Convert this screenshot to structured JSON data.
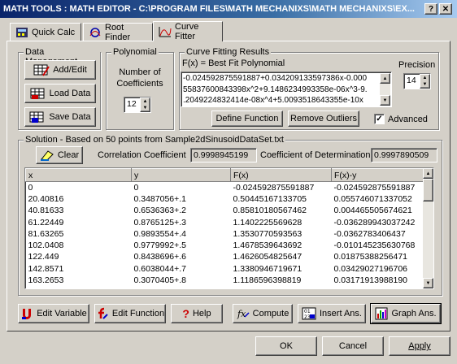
{
  "window": {
    "title": "MATH TOOLS : MATH EDITOR - C:\\PROGRAM FILES\\MATH MECHANIXS\\MATH MECHANIXS\\EX...",
    "help_label": "?",
    "close_label": "✕"
  },
  "tabs": [
    {
      "label": "Quick Calc",
      "icon": "calculator-icon"
    },
    {
      "label": "Root Finder",
      "icon": "root-finder-icon"
    },
    {
      "label": "Curve Fitter",
      "icon": "curve-icon",
      "active": true
    }
  ],
  "data_management": {
    "title": "Data Management",
    "add_edit": "Add/Edit",
    "load_data": "Load Data",
    "save_data": "Save Data"
  },
  "polynomial": {
    "title": "Polynomial",
    "coeff_label_1": "Number of",
    "coeff_label_2": "Coefficients",
    "coeff_value": "12"
  },
  "curve_fitting": {
    "title": "Curve Fitting Results",
    "formula_label": "F(x) = Best Fit Polynomial",
    "formula_lines": [
      "-0.024592875591887+0.034209133597386x-0.000",
      "55837600843398x^2+9.1486234993358e-06x^3-9.",
      ".2049224832414e-08x^4+5.0093518643355e-10x"
    ],
    "precision_label": "Precision",
    "precision_value": "14",
    "define_function": "Define Function",
    "remove_outliers": "Remove Outliers",
    "advanced_label": "Advanced",
    "advanced_checked": true
  },
  "solution": {
    "title": "Solution - Based on 50 points from Sample2dSinusoidDataSet.txt",
    "clear_label": "Clear",
    "correlation_label": "Correlation Coefficient",
    "correlation_value": "0.9998945199",
    "determination_label": "Coefficient of Determination",
    "determination_value": "0.9997890509"
  },
  "table": {
    "headers": [
      "x",
      "y",
      "F(x)",
      "F(x)-y"
    ],
    "rows": [
      [
        "0",
        "0",
        "-0.024592875591887",
        "-0.024592875591887"
      ],
      [
        "20.40816",
        "0.3487056+.1",
        "0.50445167133705",
        "0.055746071337052"
      ],
      [
        "40.81633",
        "0.6536363+.2",
        "0.85810180567462",
        "0.004465505674621"
      ],
      [
        "61.22449",
        "0.8765125+.3",
        "1.1402225569628",
        "-0.036289943037242"
      ],
      [
        "81.63265",
        "0.9893554+.4",
        "1.3530770593563",
        "-0.0362783406437"
      ],
      [
        "102.0408",
        "0.9779992+.5",
        "1.4678539643692",
        "-0.010145235630768"
      ],
      [
        "122.449",
        "0.8438696+.6",
        "1.4626054825647",
        "0.01875388256471"
      ],
      [
        "142.8571",
        "0.6038044+.7",
        "1.3380946719671",
        "0.03429027196706"
      ],
      [
        "163.2653",
        "0.3070405+.8",
        "1.1186596398819",
        "0.03171913988190"
      ]
    ]
  },
  "toolbar": {
    "edit_variable": "Edit Variable",
    "edit_function": "Edit Function",
    "help": "Help",
    "compute": "Compute",
    "insert_ans": "Insert Ans.",
    "graph_ans": "Graph Ans."
  },
  "dialog": {
    "ok": "OK",
    "cancel": "Cancel",
    "apply": "Apply"
  }
}
